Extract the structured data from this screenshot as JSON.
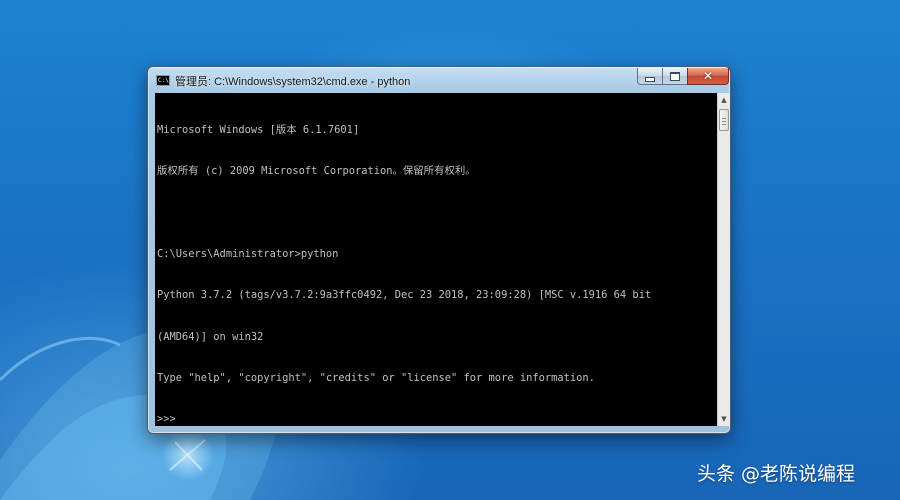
{
  "window": {
    "title": "管理员: C:\\Windows\\system32\\cmd.exe - python",
    "icon": "cmd-icon",
    "controls": {
      "minimize_icon": "minimize-icon",
      "maximize_icon": "maximize-icon",
      "close_icon": "close-icon",
      "close_glyph": "✕"
    }
  },
  "console": {
    "background": "#000000",
    "foreground": "#c0c0c0",
    "lines": [
      "Microsoft Windows [版本 6.1.7601]",
      "版权所有 (c) 2009 Microsoft Corporation。保留所有权利。",
      "",
      "C:\\Users\\Administrator>python",
      "Python 3.7.2 (tags/v3.7.2:9a3ffc0492, Dec 23 2018, 23:09:28) [MSC v.1916 64 bit",
      "(AMD64)] on win32",
      "Type \"help\", \"copyright\", \"credits\" or \"license\" for more information.",
      ">>> "
    ]
  },
  "scrollbar": {
    "up_glyph": "▲",
    "down_glyph": "▼"
  },
  "watermark": "头条 @老陈说编程",
  "colors": {
    "desktop": "#1a73c6",
    "close_button": "#c24a31"
  }
}
